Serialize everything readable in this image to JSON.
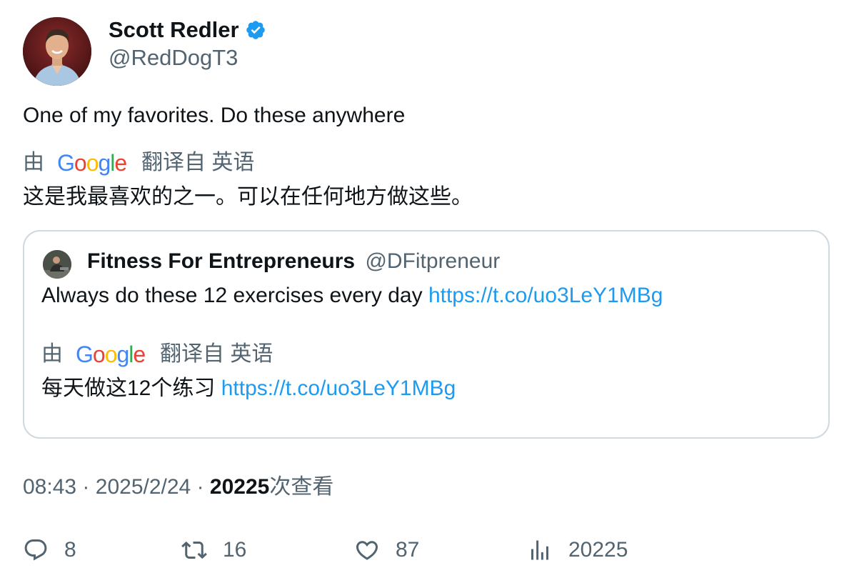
{
  "author": {
    "display_name": "Scott Redler",
    "handle": "@RedDogT3",
    "verified": true
  },
  "tweet": {
    "text": "One of my favorites. Do these anywhere",
    "translation": {
      "by_label": "由",
      "service": "Google",
      "from_label": "翻译自 英语",
      "text": "这是我最喜欢的之一。可以在任何地方做这些。"
    }
  },
  "quote": {
    "display_name": "Fitness For Entrepreneurs",
    "handle": "@DFitpreneur",
    "text": "Always do these 12 exercises every day",
    "link": "https://t.co/uo3LeY1MBg",
    "translation": {
      "by_label": "由",
      "service": "Google",
      "from_label": "翻译自 英语",
      "text": "每天做这12个练习",
      "link": "https://t.co/uo3LeY1MBg"
    }
  },
  "meta": {
    "time": "08:43",
    "separator": "·",
    "date": "2025/2/24",
    "views_count": "20225",
    "views_label": "次查看"
  },
  "actions": {
    "replies": "8",
    "retweets": "16",
    "likes": "87",
    "views": "20225"
  },
  "colors": {
    "text_primary": "#0f1419",
    "text_secondary": "#536471",
    "link": "#1d9bf0",
    "verified": "#1d9bf0",
    "border": "#cfd9de"
  },
  "icons": {
    "reply": "reply-icon",
    "retweet": "retweet-icon",
    "like": "heart-icon",
    "views": "views-chart-icon",
    "verified": "verified-badge-icon"
  }
}
